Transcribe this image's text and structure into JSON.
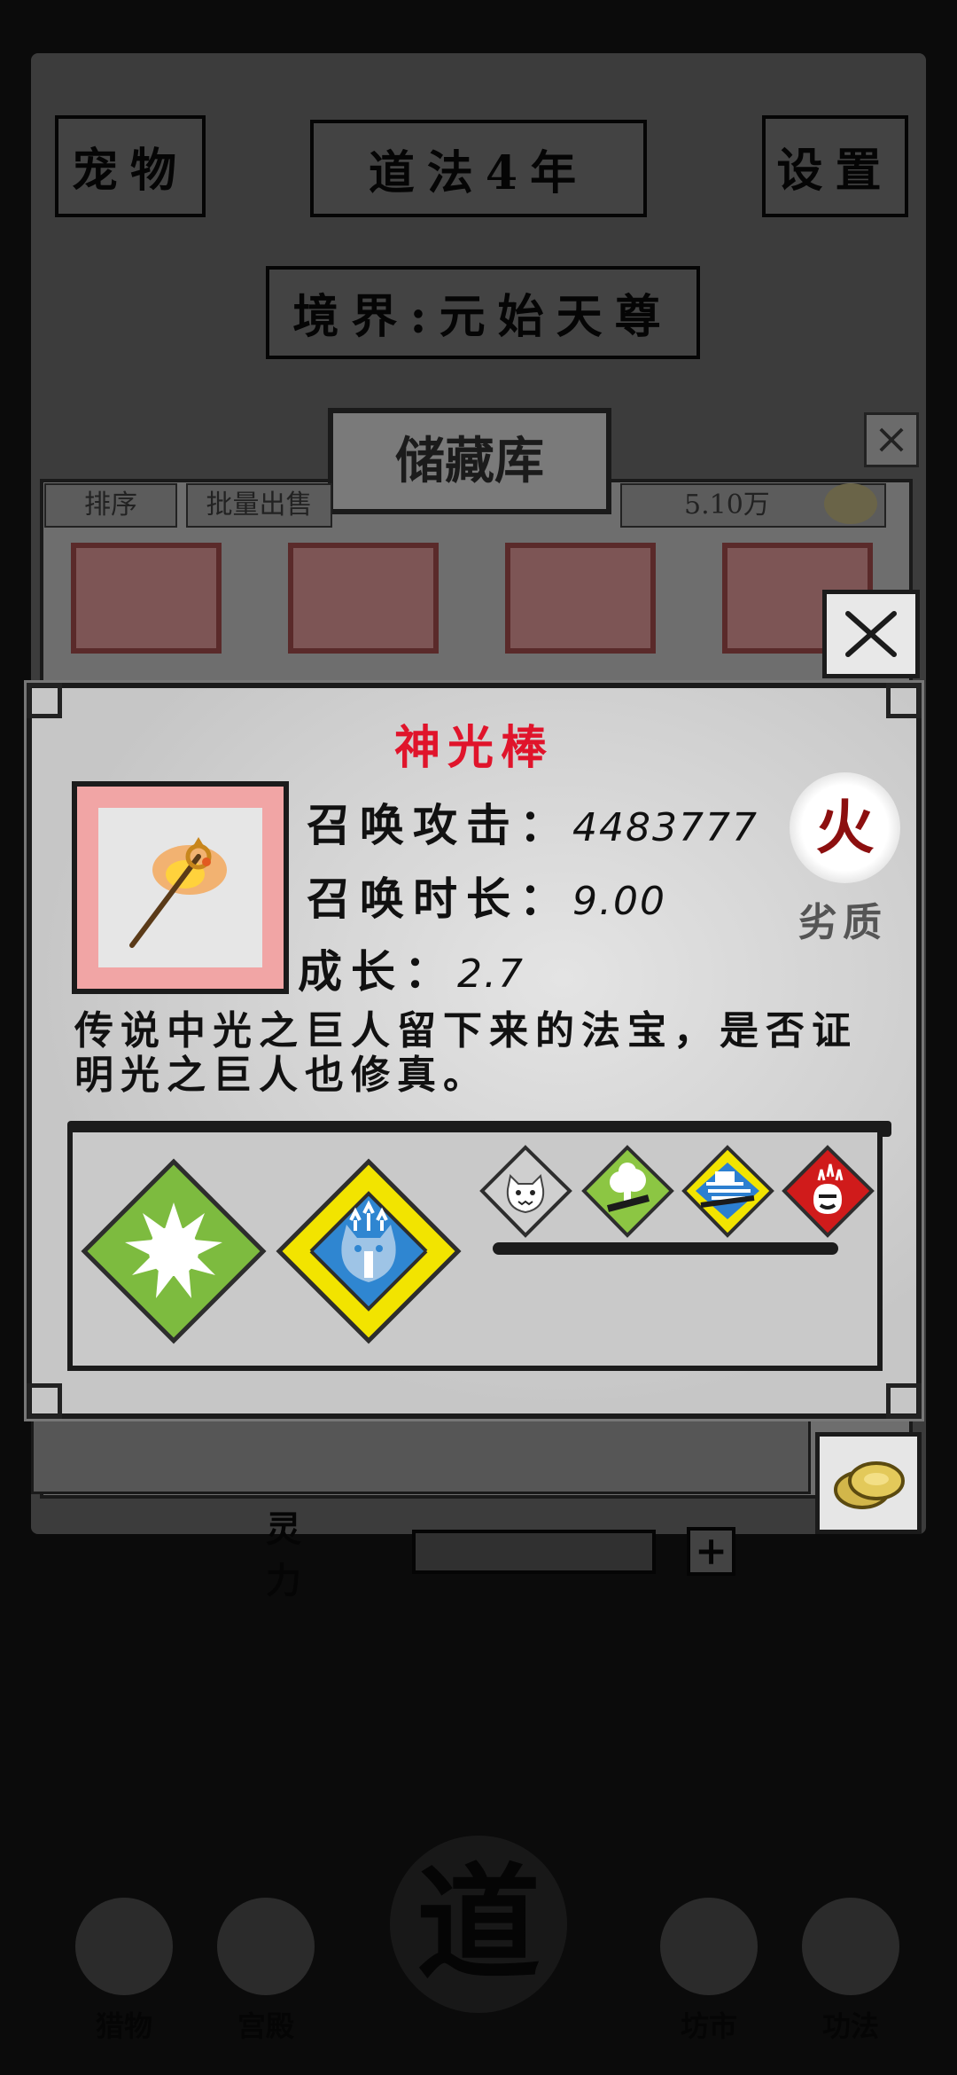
{
  "background": {
    "header_left_label": "宠物",
    "header_center_label": "道法4年",
    "header_right_label": "设置",
    "realm_label": "境界:元始天尊",
    "nav": [
      "猎物",
      "宫殿",
      "道",
      "坊市",
      "功法"
    ],
    "power_label": "灵力"
  },
  "storage": {
    "title": "储藏库",
    "sort_label": "排序",
    "batch_sell_label": "批量出售",
    "coins": "5.10万"
  },
  "item": {
    "name": "神光棒",
    "stats": [
      {
        "label": "召唤攻击",
        "sep": "：",
        "value": "4483777"
      },
      {
        "label": "召唤时长",
        "sep": "：",
        "value": "9.00"
      },
      {
        "label": "成长",
        "sep": "：",
        "value": "2.7"
      }
    ],
    "element": "火",
    "quality": "劣质",
    "description": "传说中光之巨人留下来的法宝，是否证明光之巨人也修真。"
  },
  "skills": {
    "main": [
      {
        "icon": "starburst-skill-icon",
        "color": "#7dbb3f"
      },
      {
        "icon": "cat-power-up-skill-icon",
        "color": "#2f86d1"
      }
    ],
    "sub": [
      {
        "icon": "gray-cat-skill-icon",
        "color": "#cfcfcf"
      },
      {
        "icon": "green-smoke-skill-icon",
        "color": "#8cc643"
      },
      {
        "icon": "blue-wind-skill-icon",
        "color": "#2c7fd0"
      },
      {
        "icon": "red-fire-skill-icon",
        "color": "#d01b1b"
      }
    ]
  },
  "colors": {
    "item_name": "#e0142b",
    "element_text": "#8c0f0f",
    "frame_red": "#f1a5a5"
  }
}
